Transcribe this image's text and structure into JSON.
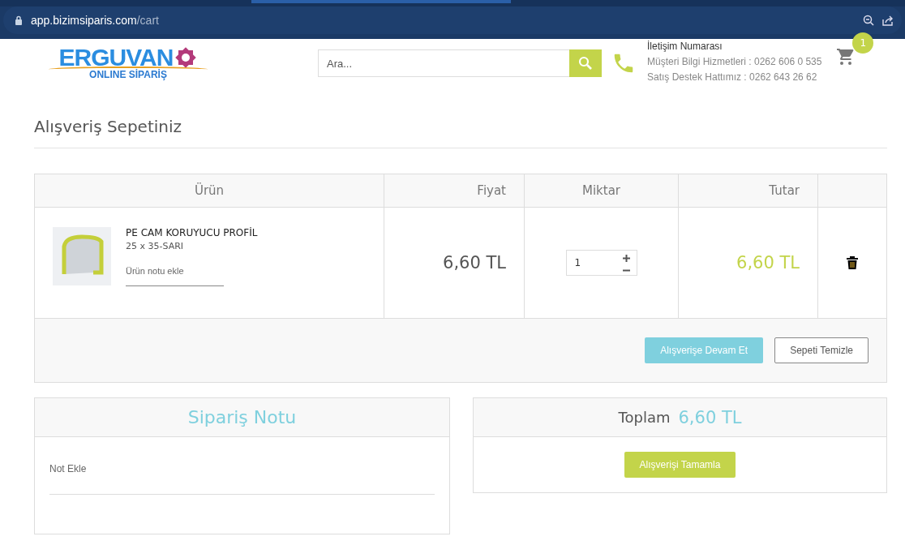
{
  "browser": {
    "url_host": "app.bizimsiparis.com",
    "url_path": "/cart"
  },
  "header": {
    "logo_title": "ERGUVAN",
    "logo_subtitle": "ONLINE SİPARİŞ",
    "search": {
      "placeholder": "Ara..."
    },
    "contact_title": "İletişim Numarası",
    "contact_lines": [
      "Müşteri Bilgi Hizmetleri : 0262 606 0 535",
      "Satış Destek Hattımız : 0262 643 26 62"
    ],
    "cart_count": "1"
  },
  "page_title": "Alışveriş Sepetiniz",
  "table": {
    "columns": [
      "Ürün",
      "Fiyat",
      "Miktar",
      "Tutar"
    ],
    "rows": [
      {
        "name": "PE CAM KORUYUCU PROFİL",
        "variant": "25 x 35-SARI",
        "note_placeholder": "Ürün notu ekle",
        "price": "6,60 TL",
        "quantity": "1",
        "total": "6,60 TL"
      }
    ]
  },
  "cart_buttons": [
    "Alışverişe Devam Et",
    "Sepeti Temizle"
  ],
  "order_note": {
    "title": "Sipariş Notu",
    "placeholder": "Not Ekle"
  },
  "summary": {
    "label": "Toplam",
    "amount": "6,60 TL",
    "button": "Alışverişi Tamamla"
  }
}
